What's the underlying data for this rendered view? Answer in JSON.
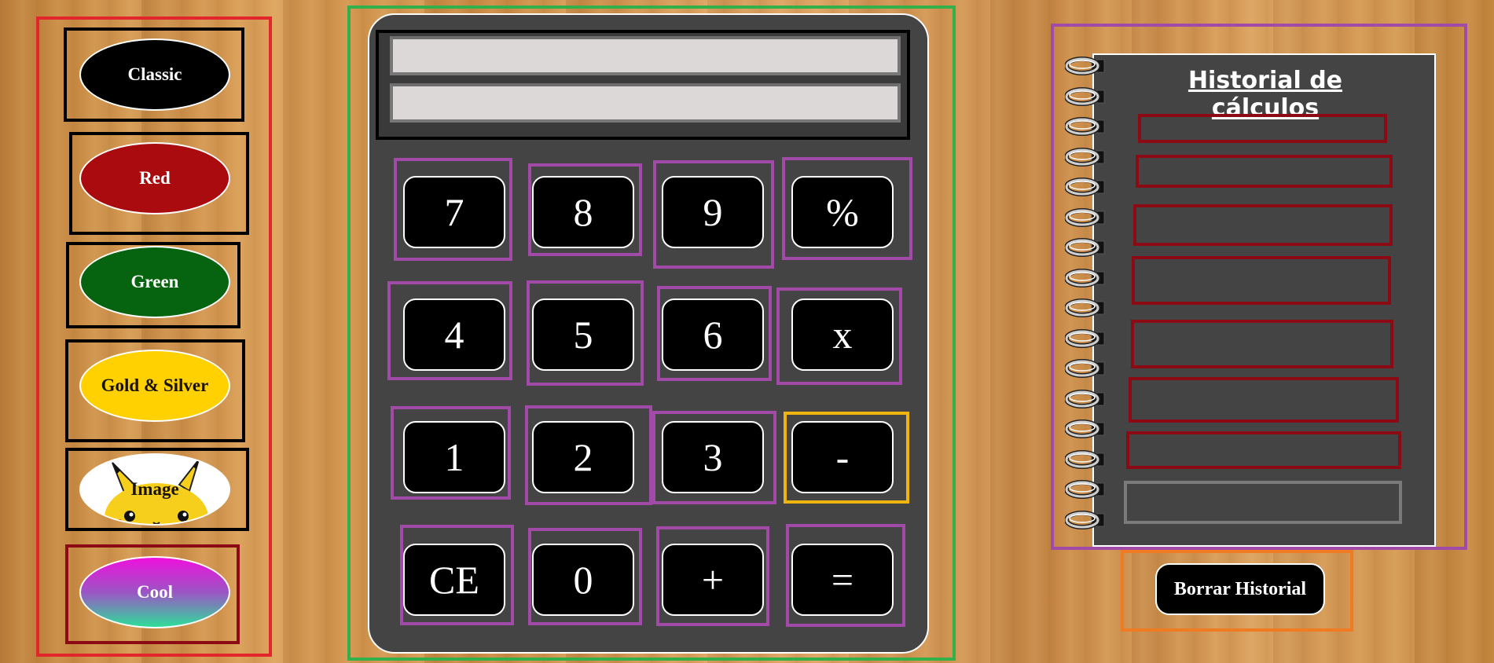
{
  "themes": {
    "classic": "Classic",
    "red": "Red",
    "green": "Green",
    "gold_silver": "Gold & Silver",
    "image": "Image",
    "cool": "Cool"
  },
  "calculator": {
    "display_top": "",
    "display_bottom": "",
    "keys": {
      "k7": "7",
      "k8": "8",
      "k9": "9",
      "percent": "%",
      "k4": "4",
      "k5": "5",
      "k6": "6",
      "multiply": "x",
      "k1": "1",
      "k2": "2",
      "k3": "3",
      "minus": "-",
      "clear": "CE",
      "k0": "0",
      "plus": "+",
      "equals": "="
    },
    "active_key": "minus",
    "accent_color": "#f0b40f"
  },
  "history": {
    "title": "Historial de cálculos",
    "entries": [
      "",
      "",
      "",
      "",
      "",
      "",
      "",
      ""
    ],
    "clear_label": "Borrar Historial"
  },
  "colors": {
    "theme_panel_border": "#e2262b",
    "calculator_border": "#33b04a",
    "history_border": "#a24aa8",
    "clear_border": "#f07b22"
  }
}
